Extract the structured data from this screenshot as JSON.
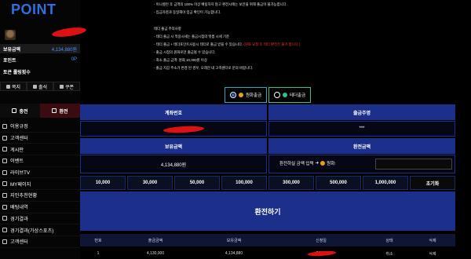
{
  "sidebar": {
    "logo": "POINT",
    "balance_label": "보유금액",
    "balance_value": "4,134,880원",
    "point_label": "포인트",
    "point_value": "0P",
    "rolling_label": "토큰 롤링횟수",
    "mini": [
      "쪽지",
      "출석",
      "쿠폰"
    ],
    "tab_deposit": "충전",
    "tab_exchange": "환전",
    "menu": [
      "이용규정",
      "고객센터",
      "게시판",
      "이벤트",
      "라이브TV",
      "MY페이지",
      "지인추천현황",
      "배팅내역",
      "경기결과",
      "경기결과(가상스포츠)",
      "고객센터"
    ]
  },
  "notice": [
    {
      "text": "- 이니셜런 후 금액의 100% 이상 배팅하지 않고 환전시에는 보안을 위해 출금이 불가능합니다.",
      "red": ""
    },
    {
      "text": "- 입금자명과 동일해야 입금 확인이 가능합니다.",
      "red": ""
    },
    {
      "text": "테더 출금 주의사항",
      "red": ""
    },
    {
      "text": "- 테더 출금 시 적용시세는 출금시점의 빗썸 시세 기준",
      "red": ""
    },
    {
      "text": "- 테더 출금 + 테더포인트사용시 테더로 출금 받을 수 있습니다.",
      "red": "(원화 요청 후 테더 환전은 불가 합니다.)"
    },
    {
      "text": "- 출금 시점의 원화로만 출금될 수 있습니다.",
      "red": ""
    },
    {
      "text": "- 최소 출금 금액: 원화 10,000원 이상",
      "red": ""
    },
    {
      "text": "- 출금 지갑 주소가 변경 된 경우, 오래전 내 고객센터로 문의 바랍니다.",
      "red": ""
    }
  ],
  "methods": {
    "krw": "원화출금",
    "usdt": "테더출금"
  },
  "form": {
    "account_header": "계좌번호",
    "holder_header": "출금주명",
    "holder_value": "***",
    "balance_header": "보유금액",
    "balance_value": "4,134,880원",
    "exchange_header": "환전금액",
    "exchange_label": "환전하실 금액 입력",
    "exchange_unit": "원화:"
  },
  "amounts": [
    "10,000",
    "30,000",
    "50,000",
    "100,000",
    "300,000",
    "500,000",
    "1,000,000",
    "초기화"
  ],
  "submit_label": "환전하기",
  "table": {
    "headers": [
      "번호",
      "출금금액",
      "보유금액",
      "신청일",
      "상태",
      "삭제"
    ],
    "rows": [
      [
        "1",
        "4,130,000",
        "4,134,880",
        "2025-",
        "취소",
        "삭제"
      ]
    ]
  },
  "colors": {
    "primary": "#1c2f8a",
    "accent_blue": "#2f6fe0",
    "redaction": "#dd1111"
  }
}
